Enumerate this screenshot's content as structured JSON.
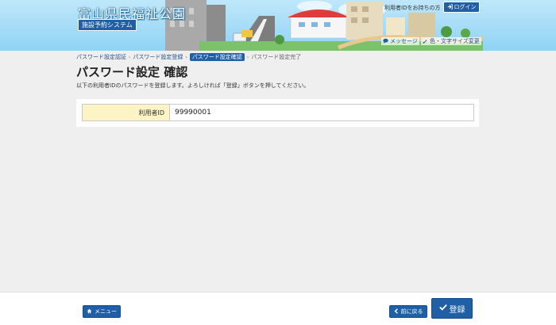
{
  "header": {
    "site_title": "富山県民福祉公園",
    "site_subtitle": "施設予約システム",
    "user_id_holder": "利用者IDをお持ちの方",
    "login_label": "ログイン",
    "message_label": "メッセージ",
    "font_label": "色・文字サイズ変更"
  },
  "breadcrumb": [
    "パスワード設定認証",
    "パスワード設定登録",
    "パスワード設定確認",
    "パスワード設定完了"
  ],
  "page": {
    "title": "パスワード設定 確認",
    "description": "以下の利用者IDのパスワードを登録します。よろしければ「登録」ボタンを押してください。"
  },
  "form": {
    "user_id_label": "利用者ID",
    "user_id_value": "99990001"
  },
  "footer": {
    "menu_label": "メニュー",
    "back_label": "前に戻る",
    "register_label": "登録"
  },
  "colors": {
    "primary": "#1f5fa5",
    "label_bg": "#fdf4c6",
    "page_bg": "#efefef"
  }
}
